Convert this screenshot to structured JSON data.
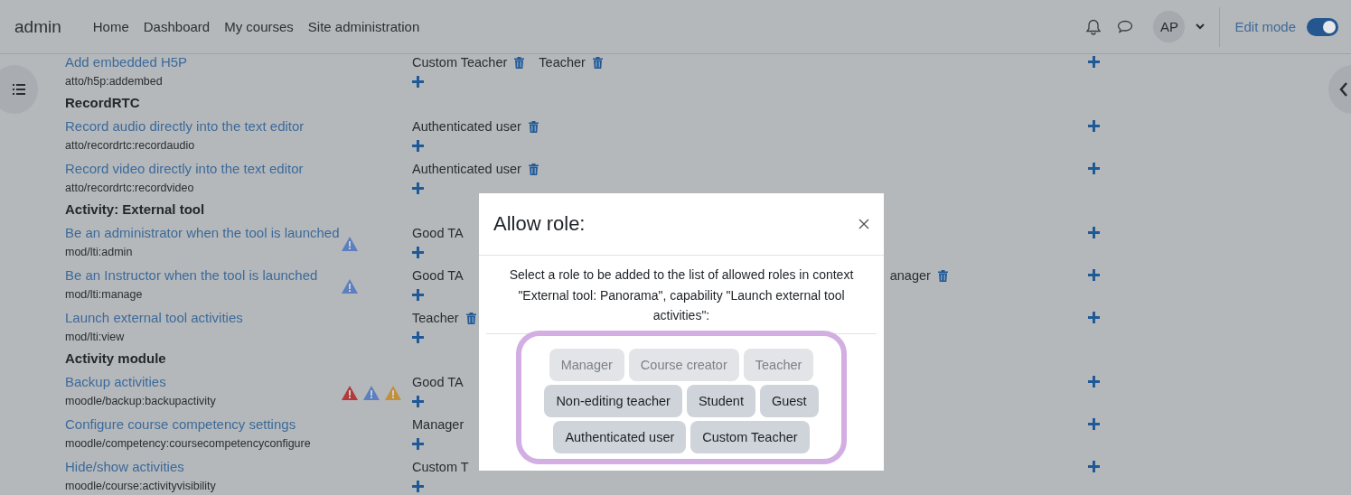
{
  "navbar": {
    "brand": "admin",
    "links": [
      "Home",
      "Dashboard",
      "My courses",
      "Site administration"
    ],
    "avatar": "AP",
    "edit_mode": {
      "label": "Edit mode",
      "on": true
    }
  },
  "capabilities": [
    {
      "kind": "capability",
      "name": "Add embedded H5P",
      "code": "atto/h5p:addembed",
      "roles": [
        {
          "label": "Custom Teacher",
          "trash": true
        },
        {
          "label": "Teacher",
          "trash": true
        }
      ]
    },
    {
      "kind": "heading",
      "name": "RecordRTC"
    },
    {
      "kind": "capability",
      "name": "Record audio directly into the text editor",
      "code": "atto/recordrtc:recordaudio",
      "roles": [
        {
          "label": "Authenticated user",
          "trash": true
        }
      ]
    },
    {
      "kind": "capability",
      "name": "Record video directly into the text editor",
      "code": "atto/recordrtc:recordvideo",
      "roles": [
        {
          "label": "Authenticated user",
          "trash": true
        }
      ]
    },
    {
      "kind": "heading",
      "name": "Activity: External tool"
    },
    {
      "kind": "capability",
      "name": "Be an administrator when the tool is launched",
      "code": "mod/lti:admin",
      "risks": [
        {
          "color": "#5b7fbf"
        }
      ],
      "roles": [
        {
          "label": "Good TA",
          "trash": false
        }
      ]
    },
    {
      "kind": "capability",
      "name": "Be an Instructor when the tool is launched",
      "code": "mod/lti:manage",
      "risks": [
        {
          "color": "#5b7fbf"
        }
      ],
      "roles": [
        {
          "label": "Good TA",
          "trash": false
        },
        {
          "label": "anager",
          "trash": true,
          "kind": "beyond"
        }
      ]
    },
    {
      "kind": "capability",
      "name": "Launch external tool activities",
      "code": "mod/lti:view",
      "roles": [
        {
          "label": "Teacher",
          "trash": true
        }
      ]
    },
    {
      "kind": "heading",
      "name": "Activity module"
    },
    {
      "kind": "capability",
      "name": "Backup activities",
      "code": "moodle/backup:backupactivity",
      "risks": [
        {
          "color": "#b33a3a"
        },
        {
          "color": "#5b7fbf"
        },
        {
          "color": "#c2903a"
        }
      ],
      "roles": [
        {
          "label": "Good TA",
          "trash": false
        }
      ]
    },
    {
      "kind": "capability",
      "name": "Configure course competency settings",
      "code": "moodle/competency:coursecompetencyconfigure",
      "roles": [
        {
          "label": "Manager",
          "trash": false
        }
      ]
    },
    {
      "kind": "capability",
      "name": "Hide/show activities",
      "code": "moodle/course:activityvisibility",
      "roles": [
        {
          "label": "Custom T",
          "trash": false
        }
      ]
    }
  ],
  "dialog": {
    "title": "Allow role:",
    "message": "Select a role to be added to the list of allowed roles in context \"External tool: Panorama\", capability \"Launch external tool activities\":",
    "role_rows": [
      [
        {
          "label": "Manager",
          "disabled": true
        },
        {
          "label": "Course creator",
          "disabled": true
        },
        {
          "label": "Teacher",
          "disabled": true
        }
      ],
      [
        {
          "label": "Non-editing teacher",
          "disabled": false
        },
        {
          "label": "Student",
          "disabled": false
        },
        {
          "label": "Guest",
          "disabled": false
        }
      ],
      [
        {
          "label": "Authenticated user",
          "disabled": false
        },
        {
          "label": "Custom Teacher",
          "disabled": false
        }
      ]
    ]
  }
}
